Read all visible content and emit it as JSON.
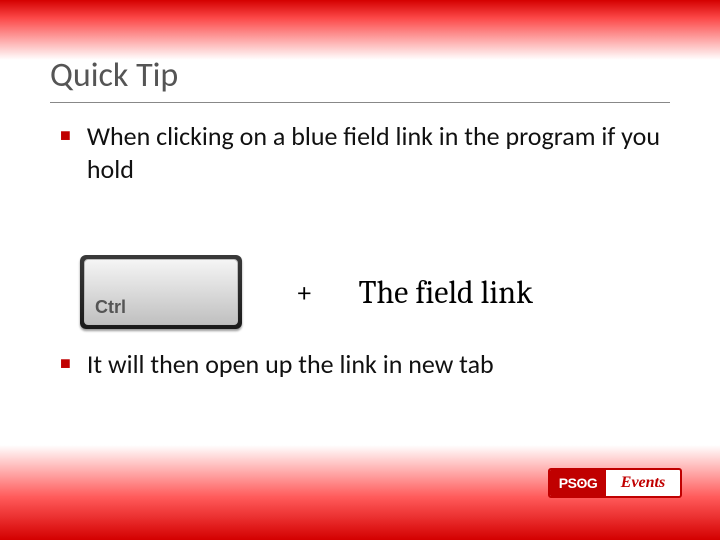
{
  "title": "Quick Tip",
  "bullets": {
    "b1": "When clicking on a blue field link in the program if you hold",
    "b2": "It will then open up the link in new tab"
  },
  "key": {
    "label": "Ctrl"
  },
  "plus": "+",
  "field_link_text": "The field link",
  "logo": {
    "brand": "PSʘG",
    "word": "Events"
  }
}
